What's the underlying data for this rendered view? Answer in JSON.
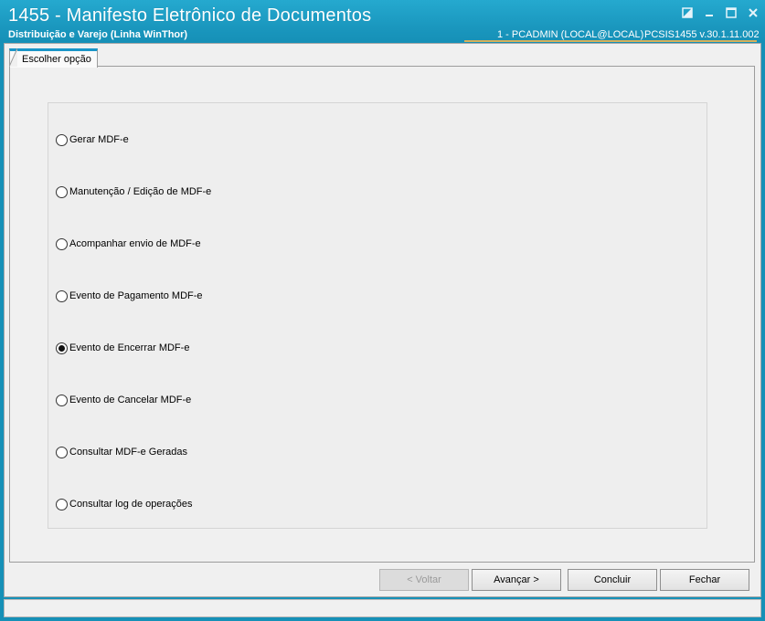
{
  "window": {
    "title": "1455 - Manifesto Eletrônico de Documentos",
    "subtitle": "Distribuição e Varejo (Linha WinThor)",
    "user_info": "1 - PCADMIN (LOCAL@LOCAL)",
    "version_info": "PCSIS1455  v.30.1.11.002"
  },
  "tabs": [
    {
      "label": "Escolher opção"
    }
  ],
  "options": [
    {
      "label": "Gerar MDF-e",
      "checked": false
    },
    {
      "label": "Manutenção / Edição de MDF-e",
      "checked": false
    },
    {
      "label": "Acompanhar envio de MDF-e",
      "checked": false
    },
    {
      "label": "Evento de Pagamento MDF-e",
      "checked": false
    },
    {
      "label": "Evento de Encerrar MDF-e",
      "checked": true
    },
    {
      "label": "Evento de Cancelar MDF-e",
      "checked": false
    },
    {
      "label": "Consultar MDF-e Geradas",
      "checked": false
    },
    {
      "label": "Consultar log de operações",
      "checked": false
    }
  ],
  "buttons": {
    "back": "< Voltar",
    "next": "Avançar >",
    "finish": "Concluir",
    "close": "Fechar"
  },
  "icons": {
    "restore": "restore-icon",
    "minimize": "minimize-icon",
    "maximize": "maximize-icon",
    "close": "close-icon"
  },
  "colors": {
    "titlebar": "#1a97be",
    "tab_accent": "#1a96c8",
    "gold_accent": "#d6b15a"
  }
}
